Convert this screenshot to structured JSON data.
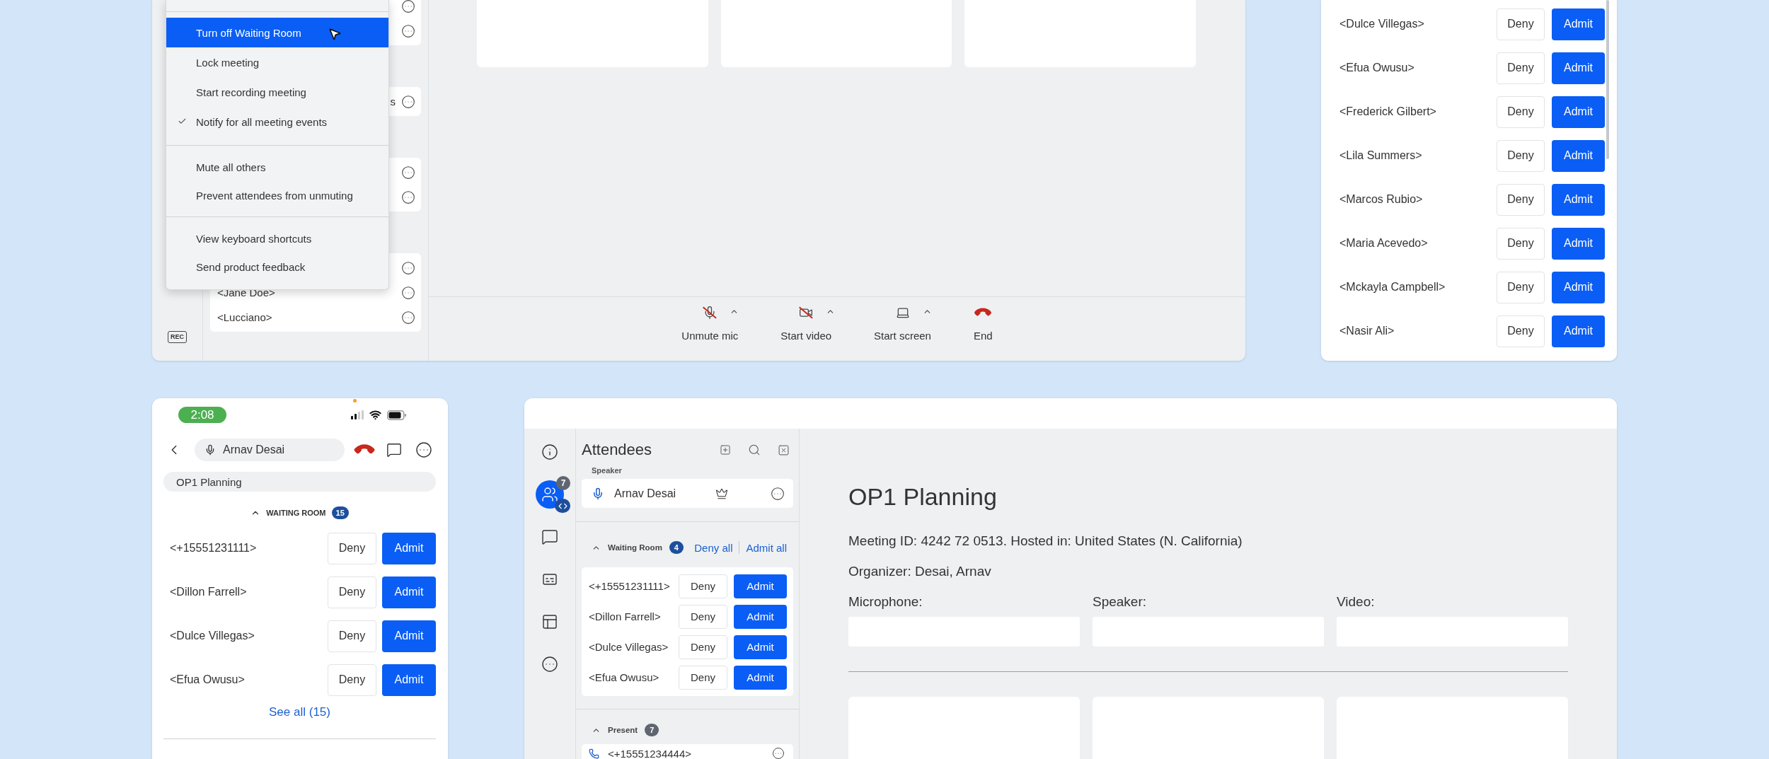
{
  "meeting_window": {
    "rec_label": "REC",
    "attendee_cards": [
      {
        "rows": [
          {
            "kind": "hidden"
          },
          {
            "kind": "hidden"
          }
        ]
      },
      {
        "rows": [
          {
            "kind": "cut",
            "name": "s"
          }
        ]
      },
      {
        "rows": [
          {
            "kind": "hidden"
          },
          {
            "kind": "hidden"
          }
        ]
      },
      {
        "rows": [
          {
            "kind": "hidden"
          },
          {
            "kind": "name",
            "name": "<Jane Doe>"
          },
          {
            "kind": "name",
            "name": "<Lucciano>"
          }
        ]
      }
    ],
    "menu": {
      "sections": [
        [
          {
            "label": "Turn off Waiting Room",
            "selected": true,
            "checked": false
          },
          {
            "label": "Lock meeting",
            "selected": false,
            "checked": false
          },
          {
            "label": "Start recording meeting",
            "selected": false,
            "checked": false
          },
          {
            "label": "Notify for all meeting events",
            "selected": false,
            "checked": true
          }
        ],
        [
          {
            "label": "Mute all others",
            "selected": false,
            "checked": false
          },
          {
            "label": "Prevent attendees from unmuting",
            "selected": false,
            "checked": false
          }
        ],
        [
          {
            "label": "View keyboard shortcuts",
            "selected": false,
            "checked": false
          },
          {
            "label": "Send product feedback",
            "selected": false,
            "checked": false
          }
        ]
      ]
    },
    "toolbar": [
      {
        "kind": "mic",
        "label": "Unmute mic",
        "caret": true
      },
      {
        "kind": "video",
        "label": "Start video",
        "caret": true
      },
      {
        "kind": "screen",
        "label": "Start screen",
        "caret": true
      },
      {
        "kind": "end",
        "label": "End",
        "caret": false
      }
    ]
  },
  "waiting_list": {
    "rows": [
      {
        "name": "<Dulce Villegas>",
        "deny": "Deny",
        "admit": "Admit"
      },
      {
        "name": "<Efua Owusu>",
        "deny": "Deny",
        "admit": "Admit"
      },
      {
        "name": "<Frederick Gilbert>",
        "deny": "Deny",
        "admit": "Admit"
      },
      {
        "name": "<Lila Summers>",
        "deny": "Deny",
        "admit": "Admit"
      },
      {
        "name": "<Marcos Rubio>",
        "deny": "Deny",
        "admit": "Admit"
      },
      {
        "name": "<Maria Acevedo>",
        "deny": "Deny",
        "admit": "Admit"
      },
      {
        "name": "<Mckayla Campbell>",
        "deny": "Deny",
        "admit": "Admit"
      },
      {
        "name": "<Nasir Ali>",
        "deny": "Deny",
        "admit": "Admit"
      }
    ]
  },
  "phone": {
    "time": "2:08",
    "caller": "Arnav Desai",
    "meeting_title": "OP1 Planning",
    "waiting_room": {
      "label": "WAITING ROOM",
      "count": "15",
      "expanded": true,
      "rows": [
        {
          "name": "<+15551231111>",
          "deny": "Deny",
          "admit": "Admit"
        },
        {
          "name": "<Dillon Farrell>",
          "deny": "Deny",
          "admit": "Admit"
        },
        {
          "name": "<Dulce Villegas>",
          "deny": "Deny",
          "admit": "Admit"
        },
        {
          "name": "<Efua Owusu>",
          "deny": "Deny",
          "admit": "Admit"
        }
      ]
    },
    "see_all": "See all (15)"
  },
  "desktop": {
    "rail": [
      {
        "kind": "info",
        "selected": false
      },
      {
        "kind": "people",
        "selected": true,
        "badge": "7"
      },
      {
        "kind": "chat",
        "selected": false
      },
      {
        "kind": "captions",
        "selected": false
      },
      {
        "kind": "layout",
        "selected": false
      },
      {
        "kind": "more",
        "selected": false
      }
    ],
    "attendees": {
      "title": "Attendees",
      "speaker_heading": "Speaker",
      "speaker": {
        "name": "Arnav Desai"
      },
      "waiting_room": {
        "label": "Waiting Room",
        "count": "4",
        "expanded": true,
        "deny_all": "Deny all",
        "admit_all": "Admit all",
        "rows": [
          {
            "name": "<+15551231111>",
            "deny": "Deny",
            "admit": "Admit"
          },
          {
            "name": "<Dillon Farrell>",
            "deny": "Deny",
            "admit": "Admit"
          },
          {
            "name": "<Dulce Villegas>",
            "deny": "Deny",
            "admit": "Admit"
          },
          {
            "name": "<Efua Owusu>",
            "deny": "Deny",
            "admit": "Admit"
          }
        ]
      },
      "present": {
        "label": "Present",
        "count": "7",
        "expanded": true,
        "rows": [
          {
            "name": "<+15551234444>"
          }
        ]
      }
    },
    "main": {
      "title": "OP1 Planning",
      "meeting_info": "Meeting ID: 4242 72 0513. Hosted in: United States (N. California)",
      "organizer": "Organizer: Desai, Arnav",
      "device_fields": [
        {
          "label": "Microphone:"
        },
        {
          "label": "Speaker:"
        },
        {
          "label": "Video:"
        }
      ]
    }
  }
}
